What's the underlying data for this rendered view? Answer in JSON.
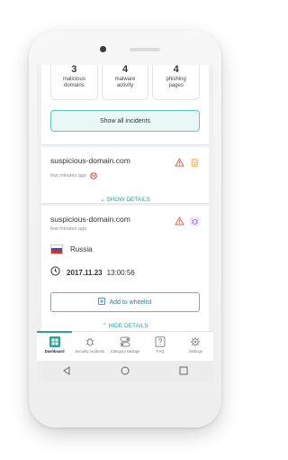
{
  "stats": [
    {
      "count": "3",
      "label_line1": "malicious",
      "label_line2": "domains"
    },
    {
      "count": "4",
      "label_line1": "malware",
      "label_line2": "activity"
    },
    {
      "count": "4",
      "label_line1": "phishing",
      "label_line2": "pages"
    }
  ],
  "show_all_label": "Show all incidents",
  "incidents": [
    {
      "domain": "suspicious-domain.com",
      "time": "few minutes ago",
      "toggle_label": "SHOW DETAILS"
    },
    {
      "domain": "suspicious-domain.com",
      "time": "few minutes ago",
      "country": "Russia",
      "date": "2017.11.23",
      "clock": "13:00:56",
      "whitelist_label": "Add to whitelist",
      "toggle_label": "HIDE DETAILS"
    }
  ],
  "nav": [
    {
      "label": "Dashboard",
      "icon": "dashboard-icon",
      "active": true
    },
    {
      "label": "Security incidents",
      "icon": "bug-icon",
      "active": false
    },
    {
      "label": "Category settings",
      "icon": "toggle-icon",
      "active": false
    },
    {
      "label": "FAQ",
      "icon": "question-icon",
      "active": false
    },
    {
      "label": "Settings",
      "icon": "gear-icon",
      "active": false
    }
  ],
  "colors": {
    "accent": "#2aa59a",
    "warning": "#e05a4a",
    "doc": "#f0a640",
    "malware": "#9b6fd6",
    "flag_white": "#ffffff",
    "flag_blue": "#2f5bb7",
    "flag_red": "#d9302c"
  }
}
